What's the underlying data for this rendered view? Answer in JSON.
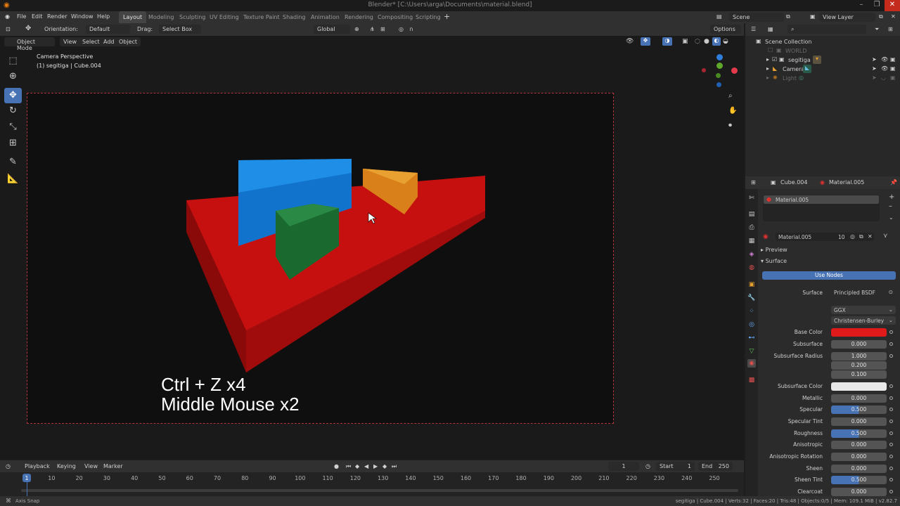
{
  "window": {
    "title": "Blender* [C:\\Users\\arga\\Documents\\material.blend]"
  },
  "menu": [
    "File",
    "Edit",
    "Render",
    "Window",
    "Help"
  ],
  "workspaces": [
    "Layout",
    "Modeling",
    "Sculpting",
    "UV Editing",
    "Texture Paint",
    "Shading",
    "Animation",
    "Rendering",
    "Compositing",
    "Scripting"
  ],
  "scene": {
    "name": "Scene",
    "view_layer": "View Layer"
  },
  "toolheader": {
    "orientation_label": "Orientation:",
    "orientation_value": "Default",
    "drag_label": "Drag:",
    "drag_value": "Select Box",
    "transform_orientation": "Global",
    "options": "Options"
  },
  "viewport_header": {
    "mode": "Object Mode",
    "menus": [
      "View",
      "Select",
      "Add",
      "Object"
    ]
  },
  "viewport": {
    "camera_label": "Camera Perspective",
    "object_label": "(1) segitiga | Cube.004",
    "overlay_line1": "Ctrl + Z x4",
    "overlay_line2": "Middle Mouse x2"
  },
  "timeline": {
    "menus": [
      "Playback",
      "Keying",
      "View",
      "Marker"
    ],
    "current_frame": "1",
    "start_label": "Start",
    "start": "1",
    "end_label": "End",
    "end": "250",
    "ruler": [
      "1",
      "10",
      "20",
      "30",
      "40",
      "50",
      "60",
      "70",
      "80",
      "90",
      "100",
      "110",
      "120",
      "130",
      "140",
      "150",
      "160",
      "170",
      "180",
      "190",
      "200",
      "210",
      "220",
      "230",
      "240",
      "250"
    ]
  },
  "statusbar": {
    "left": "Axis Snap",
    "right": "segitiga | Cube.004 | Verts:32 | Faces:20 | Tris:48 | Objects:0/5 | Mem: 109.1 MiB | v2.82.7"
  },
  "outliner": {
    "root": "Scene Collection",
    "items": [
      {
        "label": "WORLD",
        "dim": true
      },
      {
        "label": "segitiga",
        "dim": false
      },
      {
        "label": "Camera",
        "dim": false
      },
      {
        "label": "Light",
        "dim": true
      }
    ]
  },
  "properties": {
    "object": "Cube.004",
    "material": "Material.005",
    "slot": "Material.005",
    "datablock": "Material.005",
    "users": "10",
    "panels": {
      "preview": "Preview",
      "surface": "Surface"
    },
    "use_nodes": "Use Nodes",
    "surface_label": "Surface",
    "surface_value": "Principled BSDF",
    "distribution": "GGX",
    "subsurface_method": "Christensen-Burley",
    "base_color_hex": "#e01a1a",
    "subsurface_color_hex": "#e8e8e8",
    "fields": [
      {
        "label": "Base Color",
        "value": ""
      },
      {
        "label": "Subsurface",
        "value": "0.000"
      },
      {
        "label": "Subsurface Radius",
        "value": "1.000"
      },
      {
        "label": "",
        "value": "0.200"
      },
      {
        "label": "",
        "value": "0.100"
      },
      {
        "label": "Subsurface Color",
        "value": ""
      },
      {
        "label": "Metallic",
        "value": "0.000"
      },
      {
        "label": "Specular",
        "value": "0.500"
      },
      {
        "label": "Specular Tint",
        "value": "0.000"
      },
      {
        "label": "Roughness",
        "value": "0.500"
      },
      {
        "label": "Anisotropic",
        "value": "0.000"
      },
      {
        "label": "Anisotropic Rotation",
        "value": "0.000"
      },
      {
        "label": "Sheen",
        "value": "0.000"
      },
      {
        "label": "Sheen Tint",
        "value": "0.500"
      },
      {
        "label": "Clearcoat",
        "value": "0.000"
      }
    ]
  },
  "colors": {
    "accent": "#4772b3",
    "red_object": "#c61010",
    "blue_object": "#1273cc",
    "green_object": "#1a6a30",
    "orange_object": "#d9801a",
    "camera_frame": "#b0353d"
  }
}
